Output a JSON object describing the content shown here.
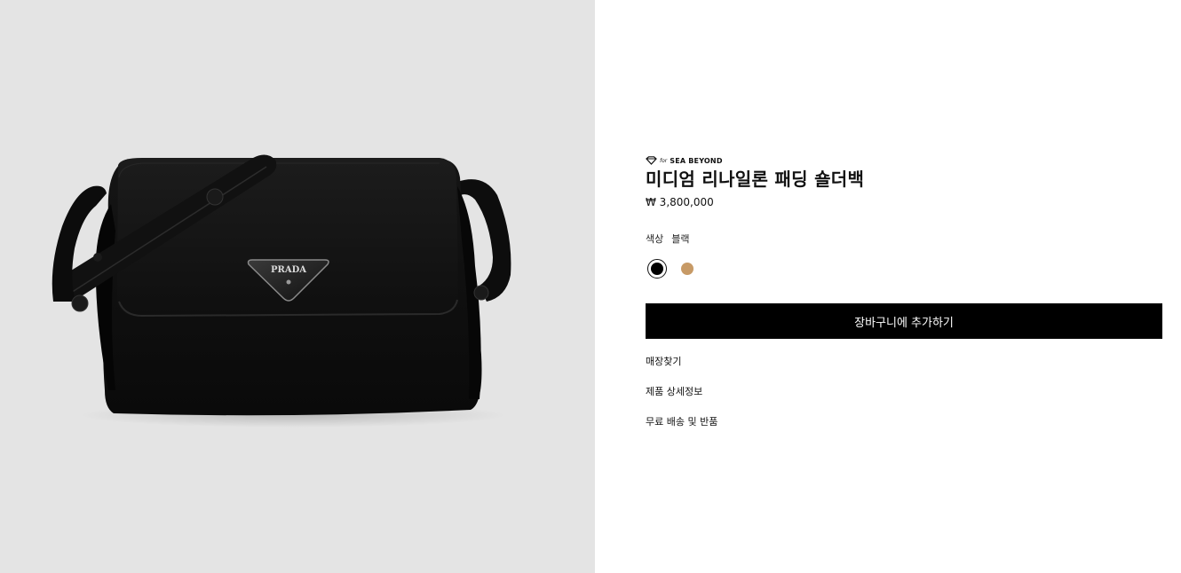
{
  "product_image": {
    "logo_text": "PRADA",
    "background": "#e4e4e4"
  },
  "badge": {
    "prefix": "for",
    "brand": "SEA BEYOND"
  },
  "product": {
    "title": "미디엄 리나일론 패딩 숄더백",
    "price": "₩ 3,800,000"
  },
  "color": {
    "label": "색상",
    "selected": "블랙",
    "swatches": [
      {
        "name": "블랙",
        "color": "#000000",
        "selected": true
      },
      {
        "name": "카멜",
        "color": "#c79a66",
        "selected": false
      }
    ]
  },
  "actions": {
    "add_to_cart": "장바구니에 추가하기"
  },
  "links": {
    "store_finder": "매장찾기",
    "product_details": "제품 상세정보",
    "shipping_returns": "무료 배송 및 반품"
  }
}
